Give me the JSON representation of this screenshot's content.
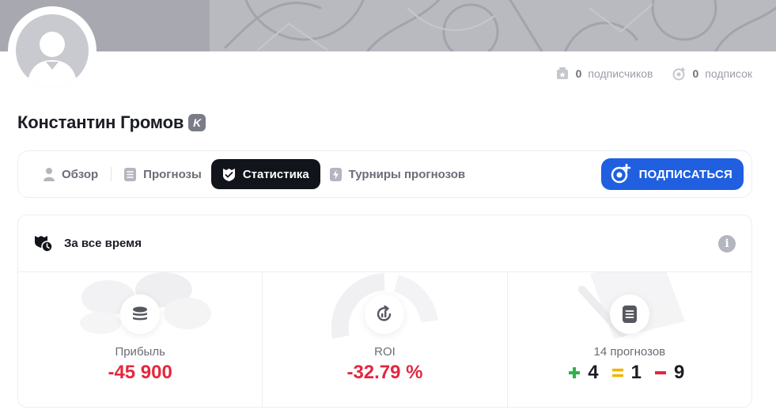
{
  "profile": {
    "name": "Константин Громов",
    "badge": "K",
    "subscribers_count": "0",
    "subscribers_label": "подписчиков",
    "subscriptions_count": "0",
    "subscriptions_label": "подписок"
  },
  "tabs": [
    {
      "label": "Обзор",
      "icon": "user-icon",
      "active": false
    },
    {
      "label": "Прогнозы",
      "icon": "list-icon",
      "active": false
    },
    {
      "label": "Статистика",
      "icon": "stats-shield-icon",
      "active": true
    },
    {
      "label": "Турниры прогнозов",
      "icon": "lightning-icon",
      "active": false
    }
  ],
  "subscribe_button": {
    "label": "ПОДПИСАТЬСЯ",
    "icon": "subscribe-plus-icon"
  },
  "stats": {
    "period_title": "За все время",
    "info_icon": "i",
    "profit": {
      "label": "Прибыль",
      "value": "-45 900",
      "icon": "coins-icon"
    },
    "roi": {
      "label": "ROI",
      "value": "-32.79 %",
      "icon": "roi-icon"
    },
    "predictions": {
      "label": "14 прогнозов",
      "icon": "document-icon",
      "wins": "4",
      "draws": "1",
      "losses": "9"
    }
  },
  "colors": {
    "accent": "#1f5fe0",
    "negative": "#e3283e",
    "win": "#2fb14a",
    "draw": "#f2b400",
    "loss": "#e3283e",
    "active_tab": "#12141b"
  }
}
